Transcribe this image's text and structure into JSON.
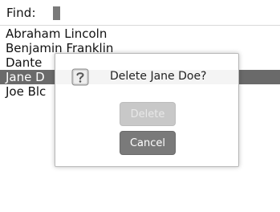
{
  "find_bar": {
    "label": "Find:",
    "value": ""
  },
  "contacts": [
    {
      "name": "Abraham Lincoln",
      "selected": false
    },
    {
      "name": "Benjamin Franklin",
      "selected": false
    },
    {
      "name": "Dante",
      "selected": false
    },
    {
      "name": "Jane D",
      "selected": true
    },
    {
      "name": "Joe Blc",
      "selected": false
    }
  ],
  "dialog": {
    "icon": "question-icon",
    "message": "Delete Jane Doe?",
    "delete_label": "Delete",
    "cancel_label": "Cancel"
  },
  "colors": {
    "selection": "#6a6a6a",
    "cancel_button": "#7a7a7a",
    "delete_button_disabled": "#c8c8c8"
  }
}
